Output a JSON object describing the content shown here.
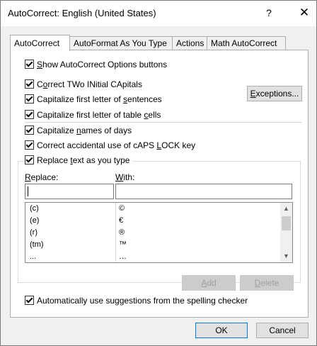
{
  "window": {
    "title": "AutoCorrect: English (United States)",
    "help": "?",
    "close": "✕"
  },
  "tabs": [
    {
      "label": "AutoCorrect",
      "active": true
    },
    {
      "label": "AutoFormat As You Type",
      "active": false
    },
    {
      "label": "Actions",
      "active": false
    },
    {
      "label": "Math AutoCorrect",
      "active": false
    }
  ],
  "options": {
    "show_buttons": {
      "pre": "",
      "key": "S",
      "post": "how AutoCorrect Options buttons",
      "checked": true
    },
    "two_initial": {
      "pre": "C",
      "key": "o",
      "post": "rrect TWo INitial CApitals",
      "checked": true
    },
    "first_sentence": {
      "pre": "Capitalize first letter of ",
      "key": "s",
      "post": "entences",
      "checked": true
    },
    "first_table": {
      "pre": "Capitalize first letter of table ",
      "key": "c",
      "post": "ells",
      "checked": true
    },
    "names_days": {
      "pre": "Capitalize ",
      "key": "n",
      "post": "ames of days",
      "checked": true
    },
    "caps_lock": {
      "pre": "Correct accidental use of cAPS ",
      "key": "L",
      "post": "OCK key",
      "checked": true
    },
    "replace_text": {
      "pre": "Replace ",
      "key": "t",
      "post": "ext as you type",
      "checked": true
    },
    "suggestions": {
      "pre": "Automatically use suggestions from the spelling checker",
      "key": "",
      "post": "",
      "checked": true
    }
  },
  "buttons": {
    "exceptions": {
      "key": "E",
      "post": "xceptions..."
    },
    "add": {
      "key": "A",
      "post": "dd"
    },
    "delete": {
      "key": "D",
      "post": "elete"
    },
    "ok": "OK",
    "cancel": "Cancel"
  },
  "replace": {
    "replace_label": {
      "key": "R",
      "post": "eplace:"
    },
    "with_label": {
      "key": "W",
      "post": "ith:"
    },
    "replace_value": "",
    "with_value": ""
  },
  "entries": [
    {
      "key": "(c)",
      "value": "©"
    },
    {
      "key": "(e)",
      "value": "€"
    },
    {
      "key": "(r)",
      "value": "®"
    },
    {
      "key": "(tm)",
      "value": "™"
    },
    {
      "key": "...",
      "value": "…"
    }
  ],
  "scroll_position": 0.0
}
